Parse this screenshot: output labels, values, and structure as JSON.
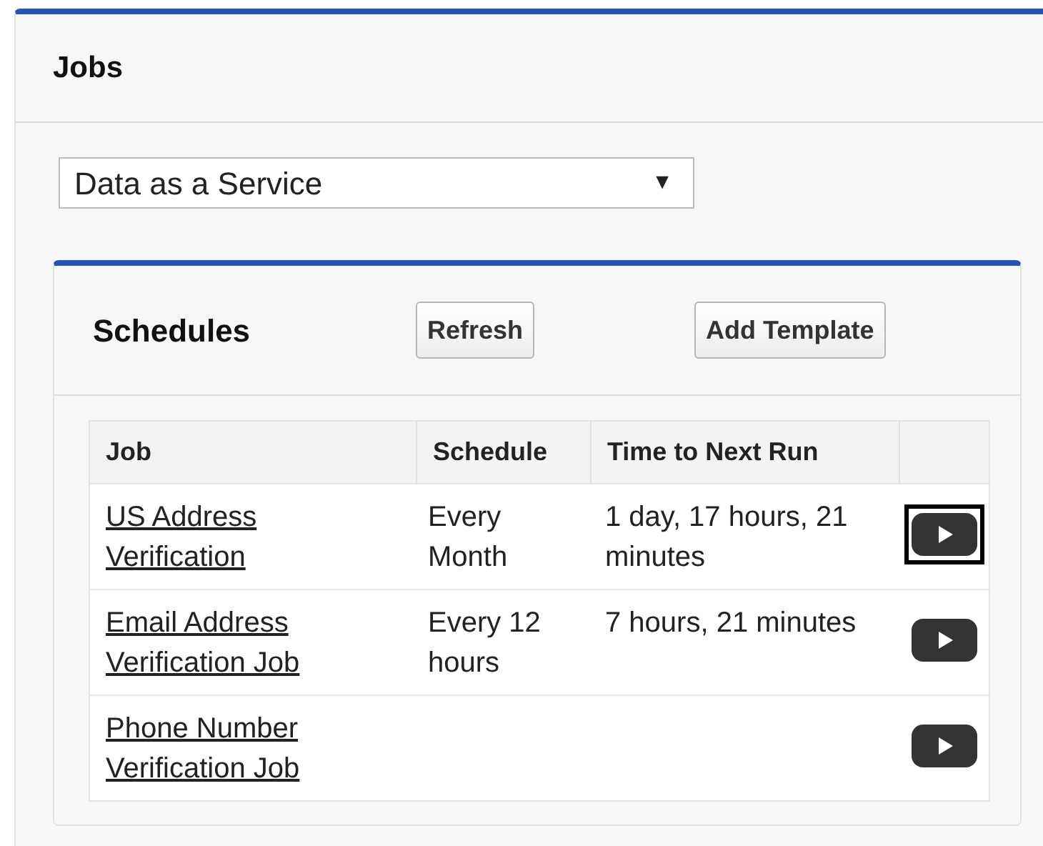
{
  "panel": {
    "title": "Jobs"
  },
  "select": {
    "value": "Data as a Service",
    "arrow": "▼"
  },
  "schedules": {
    "title": "Schedules",
    "buttons": [
      "Refresh",
      "Add Template"
    ],
    "table": {
      "columns": [
        "Job",
        "Schedule",
        "Time to Next Run"
      ],
      "rows": [
        {
          "job": "US Address Verification",
          "schedule": "Every Month",
          "time": "1 day, 17 hours, 21 minutes",
          "focused": true
        },
        {
          "job": "Email Address Verification Job",
          "schedule": "Every 12 hours",
          "time": "7 hours, 21 minutes",
          "focused": false
        },
        {
          "job": "Phone Number Verification Job",
          "focused": false
        }
      ]
    }
  }
}
